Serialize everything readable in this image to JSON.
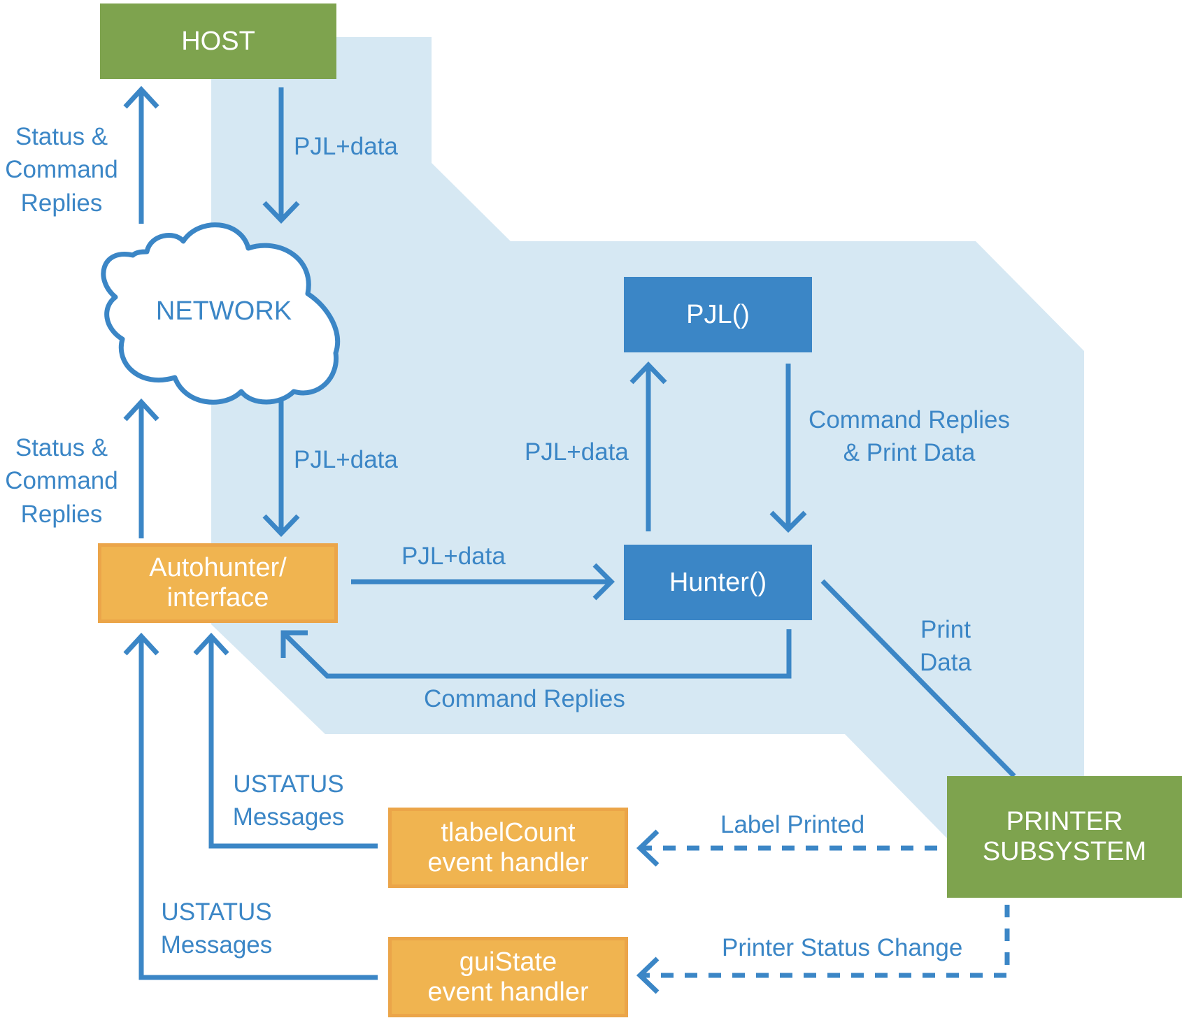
{
  "colors": {
    "host_green": "#7ea34e",
    "function_blue": "#3b86c6",
    "handler_orange": "#f0b450",
    "region_light_blue": "#d6e8f3",
    "arrow_blue": "#3b86c6",
    "text_white": "#ffffff"
  },
  "nodes": {
    "host": {
      "label": "HOST"
    },
    "network": {
      "label": "NETWORK",
      "shape": "cloud"
    },
    "pjl": {
      "label": "PJL()"
    },
    "hunter": {
      "label": "Hunter()"
    },
    "autohunter": {
      "lines": [
        "Autohunter/",
        "interface"
      ]
    },
    "tlabelcount": {
      "lines": [
        "tlabelCount",
        "event handler"
      ]
    },
    "guistate": {
      "lines": [
        "guiState",
        "event handler"
      ]
    },
    "printer": {
      "lines": [
        "PRINTER",
        "SUBSYSTEM"
      ]
    }
  },
  "edges": {
    "network_to_host": {
      "lines": [
        "Status &",
        "Command",
        "Replies"
      ],
      "style": "solid"
    },
    "host_to_network": {
      "label": "PJL+data",
      "style": "solid"
    },
    "autohunter_to_network": {
      "lines": [
        "Status &",
        "Command",
        "Replies"
      ],
      "style": "solid"
    },
    "network_to_autohunter": {
      "label": "PJL+data",
      "style": "solid"
    },
    "autohunter_to_hunter": {
      "label": "PJL+data",
      "style": "solid"
    },
    "hunter_to_pjl": {
      "label": "PJL+data",
      "style": "solid"
    },
    "pjl_to_hunter": {
      "lines": [
        "Command Replies",
        "& Print Data"
      ],
      "style": "solid"
    },
    "hunter_to_autohunter": {
      "label": "Command Replies",
      "style": "solid"
    },
    "hunter_to_printer": {
      "lines": [
        "Print",
        "Data"
      ],
      "style": "solid"
    },
    "tlabelcount_to_autohunter": {
      "lines": [
        "USTATUS",
        "Messages"
      ],
      "style": "solid"
    },
    "guistate_to_autohunter": {
      "lines": [
        "USTATUS",
        "Messages"
      ],
      "style": "solid"
    },
    "printer_to_tlabelcount": {
      "label": "Label Printed",
      "style": "dashed"
    },
    "printer_to_guistate": {
      "label": "Printer Status Change",
      "style": "dashed"
    }
  }
}
